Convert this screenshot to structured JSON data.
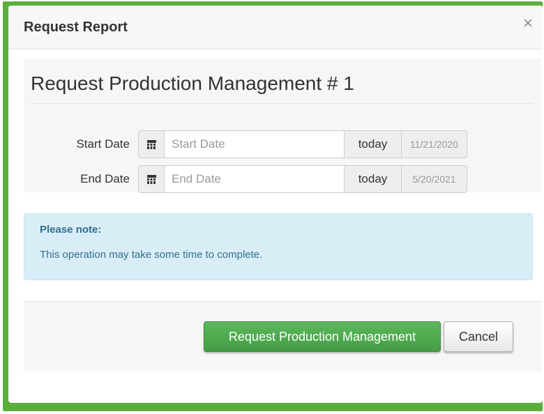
{
  "modal": {
    "title": "Request Report",
    "close_glyph": "×",
    "close_icon": "close-icon"
  },
  "form": {
    "heading": "Request Production Management # 1",
    "start_date": {
      "label": "Start Date",
      "placeholder": "Start Date",
      "value": "",
      "today_label": "today",
      "hint": "11/21/2020",
      "icon": "calendar-icon"
    },
    "end_date": {
      "label": "End Date",
      "placeholder": "End Date",
      "value": "",
      "today_label": "today",
      "hint": "5/20/2021",
      "icon": "calendar-icon"
    }
  },
  "alert": {
    "title": "Please note:",
    "body": "This operation may take some time to complete."
  },
  "footer": {
    "submit_label": "Request Production Management",
    "cancel_label": "Cancel"
  },
  "colors": {
    "accent_green": "#5cb85c",
    "info_bg": "#d9edf7",
    "info_text": "#31708f",
    "frame_green": "#5cae3c"
  }
}
